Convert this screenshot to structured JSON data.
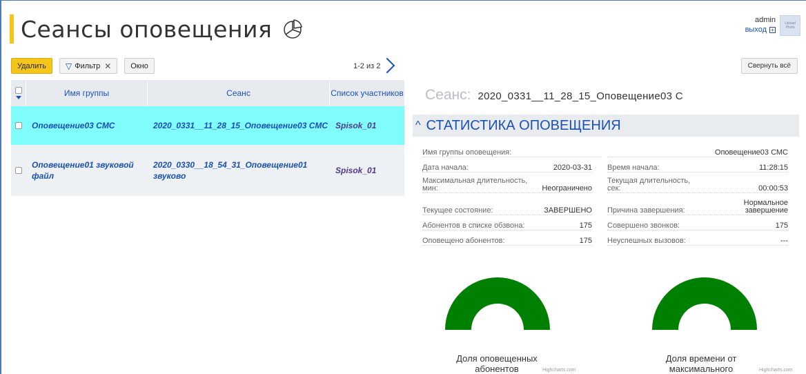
{
  "header": {
    "title": "Сеансы оповещения",
    "user_name": "admin",
    "logout_label": "выход",
    "avatar_text": "Upload Photo"
  },
  "toolbar": {
    "delete_label": "Удалить",
    "filter_label": "Фильтр",
    "window_label": "Окно",
    "pager_text": "1-2 из 2",
    "collapse_label": "Свернуть всё"
  },
  "table": {
    "columns": [
      "Имя группы",
      "Сеанс",
      "Список участников"
    ],
    "rows": [
      {
        "group": "Оповещение03 СМС",
        "session": "2020_0331__11_28_15_Оповещение03 СМС",
        "list": "Spisok_01"
      },
      {
        "group": "Оповещение01 звуковой файл",
        "session": "2020_0330__18_54_31_Оповещение01 звуково",
        "list": "Spisok_01"
      }
    ]
  },
  "detail": {
    "session_label": "Сеанс:",
    "session_value": "2020_0331__11_28_15_Оповещение03 С",
    "section_title": "СТАТИСТИКА ОПОВЕЩЕНИЯ",
    "stats": {
      "group_label": "Имя группы оповещения:",
      "group_value": "Оповещение03 СМС",
      "start_date_label": "Дата начала:",
      "start_date_value": "2020-03-31",
      "start_time_label": "Время начала:",
      "start_time_value": "11:28:15",
      "max_duration_label": "Максимальная длительность, мин:",
      "max_duration_value": "Неограничено",
      "cur_duration_label": "Текущая длительность, сек:",
      "cur_duration_value": "00:00:53",
      "state_label": "Текущее состояние:",
      "state_value": "ЗАВЕРШЕНО",
      "reason_label": "Причина завершения:",
      "reason_value": "Нормальное завершение",
      "subscribers_label": "Абонентов в списке обзвона:",
      "subscribers_value": "175",
      "calls_label": "Совершено звонков:",
      "calls_value": "175",
      "notified_label": "Оповещено абонентов:",
      "notified_value": "175",
      "failed_label": "Неуспешных вызовов:",
      "failed_value": "---"
    },
    "gauges": [
      {
        "label": "Доля оповещенных абонентов",
        "credit": "Highcharts.com",
        "fraction": 1.0,
        "color": "#008000"
      },
      {
        "label": "Доля времени от максимального",
        "credit": "Highcharts.com",
        "fraction": 1.0,
        "color": "#008000"
      }
    ]
  },
  "colors": {
    "accent": "#f5c518",
    "link": "#1a4fb5",
    "selected_row": "#80fcfc",
    "gauge": "#008000"
  }
}
